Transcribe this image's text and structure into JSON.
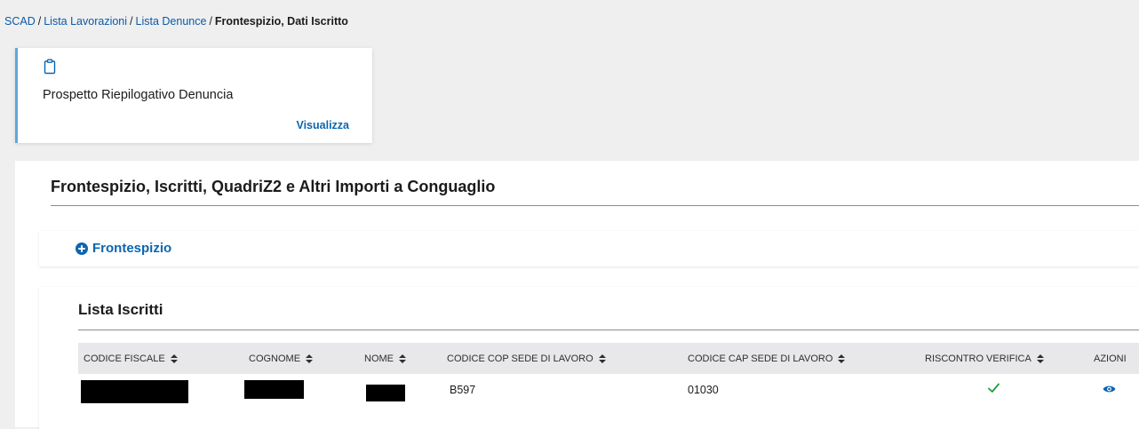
{
  "breadcrumb": {
    "items": [
      "SCAD",
      "Lista Lavorazioni",
      "Lista Denunce"
    ],
    "current": "Frontespizio, Dati Iscritto",
    "separator": "/"
  },
  "card": {
    "icon": "clipboard-icon",
    "title": "Prospetto Riepilogativo Denuncia",
    "link": "Visualizza"
  },
  "section": {
    "title": "Frontespizio, Iscritti, QuadriZ2 e Altri Importi a Conguaglio"
  },
  "accordion": {
    "icon": "plus-circle-icon",
    "label": "Frontespizio"
  },
  "list": {
    "title": "Lista Iscritti",
    "columns": [
      "CODICE FISCALE",
      "COGNOME",
      "NOME",
      "CODICE COP SEDE DI LAVORO",
      "CODICE CAP SEDE DI LAVORO",
      "RISCONTRO VERIFICA",
      "AZIONI"
    ],
    "rows": [
      {
        "codice_fiscale": "[redacted]",
        "cognome": "[redacted]",
        "nome": "[redacted]",
        "codice_cop": "B597",
        "codice_cap": "01030",
        "riscontro_verifica": "check-icon",
        "azioni": "eye-icon"
      }
    ]
  },
  "colors": {
    "accent": "#0b66b1",
    "card_border": "#5fa8d9",
    "success": "#1e9e3e",
    "background": "#efeff0",
    "table_header": "#e8e8ea"
  }
}
